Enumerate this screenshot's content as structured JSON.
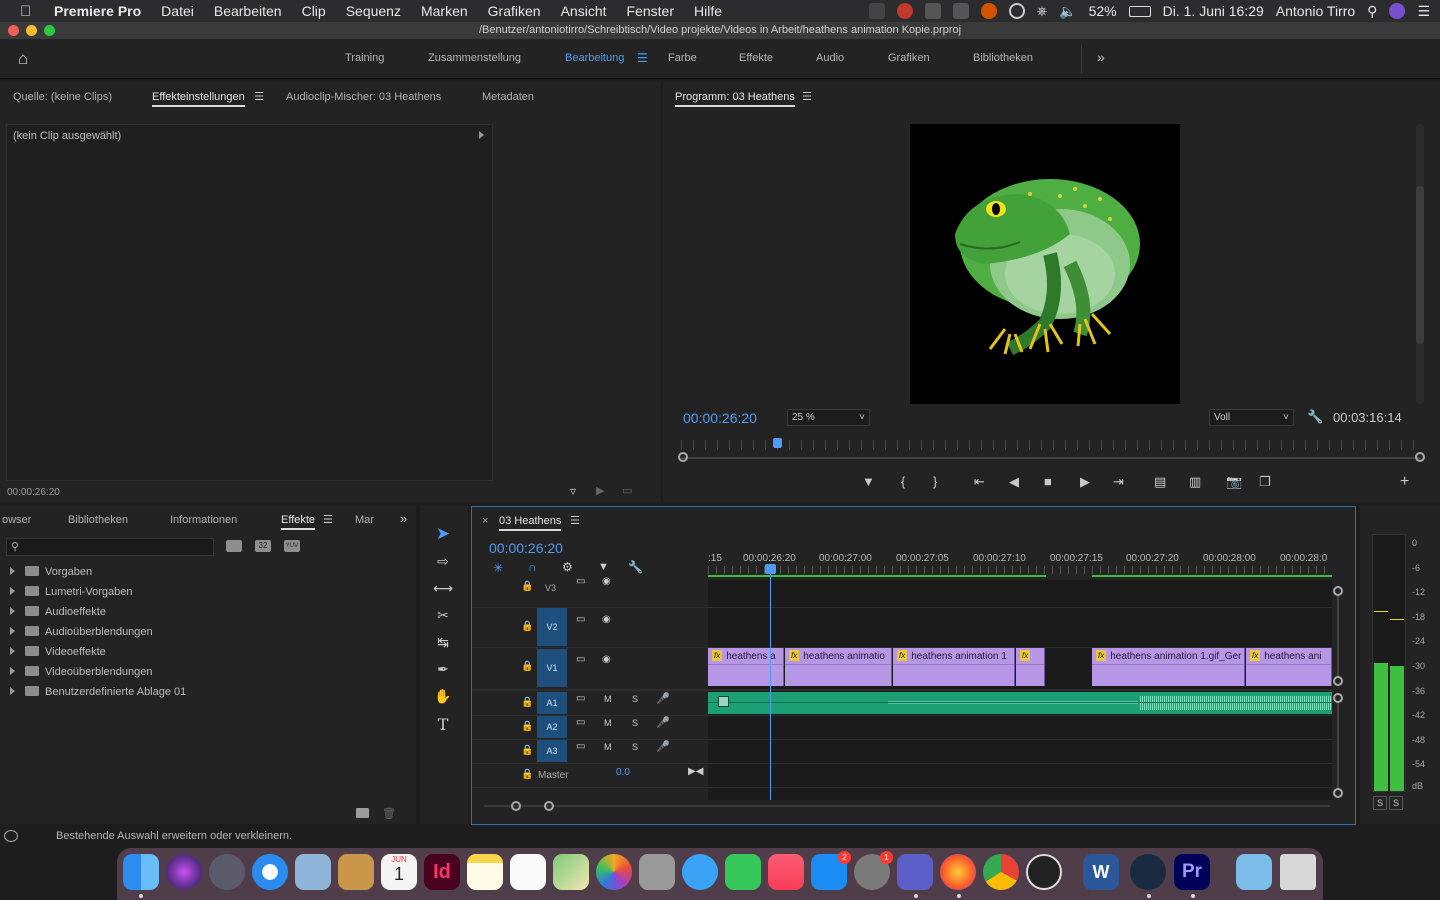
{
  "menubar": {
    "app_name": "Premiere Pro",
    "items": [
      "Datei",
      "Bearbeiten",
      "Clip",
      "Sequenz",
      "Marken",
      "Grafiken",
      "Ansicht",
      "Fenster",
      "Hilfe"
    ],
    "battery": "52%",
    "datetime": "Di. 1. Juni  16:29",
    "user": "Antonio Tirro"
  },
  "window": {
    "title": "/Benutzer/antoniotirro/Schreibtisch/Video projekte/Videos in Arbeit/heathens animation Kopie.prproj"
  },
  "workspaces": {
    "items": [
      "Training",
      "Zusammenstellung",
      "Bearbeitung",
      "Farbe",
      "Effekte",
      "Audio",
      "Grafiken",
      "Bibliotheken"
    ],
    "active": "Bearbeitung"
  },
  "source_panel": {
    "tabs": [
      "Quelle: (keine Clips)",
      "Effekteinstellungen",
      "Audioclip-Mischer: 03 Heathens",
      "Metadaten"
    ],
    "active_tab": "Effekteinstellungen",
    "no_clip": "(kein Clip ausgewählt)",
    "timecode": "00:00:26:20"
  },
  "program_monitor": {
    "title": "Programm: 03 Heathens",
    "timecode": "00:00:26:20",
    "zoom": "25 %",
    "quality": "Voll",
    "duration": "00:03:16:14"
  },
  "effects_panel": {
    "tabs": [
      "owser",
      "Bibliotheken",
      "Informationen",
      "Effekte",
      "Mar"
    ],
    "active_tab": "Effekte",
    "search_placeholder": "",
    "badge_icons": [
      "32",
      "YUV"
    ],
    "items": [
      "Vorgaben",
      "Lumetri-Vorgaben",
      "Audioeffekte",
      "Audioüberblendungen",
      "Videoeffekte",
      "Videoüberblendungen",
      "Benutzerdefinierte Ablage 01"
    ]
  },
  "timeline": {
    "sequence_name": "03 Heathens",
    "timecode": "00:00:26:20",
    "ruler": [
      ":15",
      "00:00:26:20",
      "00:00:27:00",
      "00:00:27:05",
      "00:00:27:10",
      "00:00:27:15",
      "00:00:27:20",
      "00:00:28:00",
      "00:00:28:0"
    ],
    "tracks": {
      "V3": "V3",
      "V2": "V2",
      "V1": "V1",
      "A1": "A1",
      "A2": "A2",
      "A3": "A3"
    },
    "mute_label": "M",
    "solo_label": "S",
    "master_label": "Master",
    "master_value": "0.0",
    "clips": [
      "heathens a",
      "heathens animatio",
      "heathens animation 1",
      "",
      "heathens animation 1.gif_Ger",
      "heathens ani"
    ]
  },
  "audio_meter": {
    "labels": [
      "0",
      "-6",
      "-12",
      "-18",
      "-24",
      "-30",
      "-36",
      "-42",
      "-48",
      "-54",
      "dB"
    ],
    "solo_buttons": [
      "S",
      "S"
    ]
  },
  "status_bar": {
    "text": "Bestehende Auswahl erweitern oder verkleinern."
  },
  "colors": {
    "accent": "#4f9bf5",
    "clip_video": "#b697e5",
    "clip_audio": "#2fbf8f",
    "track_label": "#1e4f7d"
  },
  "dock": {
    "calendar_month": "JUN",
    "calendar_day": "1",
    "appstore_badge": "2",
    "settings_badge": "1"
  }
}
